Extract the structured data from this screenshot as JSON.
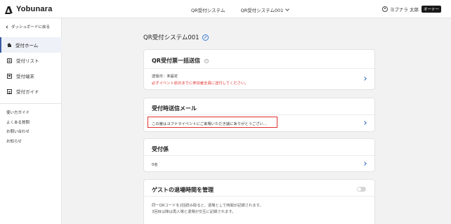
{
  "app": {
    "logo_text": "Yobunara"
  },
  "topnav": {
    "item1": "QR受付システム",
    "item2": "QR受付システム001"
  },
  "user": {
    "name": "ヨブナラ 太郎",
    "badge": "オーナー"
  },
  "sidebar": {
    "back_label": "ダッシュボードに戻る",
    "items": [
      {
        "label": "受付ホーム",
        "icon": "home-icon",
        "active": true
      },
      {
        "label": "受付リスト",
        "icon": "list-icon",
        "active": false
      },
      {
        "label": "受付端末",
        "icon": "terminal-icon",
        "active": false
      },
      {
        "label": "受付ガイド",
        "icon": "guide-icon",
        "active": false
      }
    ],
    "links": [
      "使い方ガイド",
      "よくある質問",
      "お問い合わせ",
      "お知らせ"
    ]
  },
  "main": {
    "page_title": "QR受付システム001",
    "cards": {
      "qr_send": {
        "title": "QR受付票一括送信",
        "send_date": "送信日：未設定",
        "warning": "必ずイベント前日までに参加者全員に送付してください。"
      },
      "mail": {
        "title": "受付時送信メール",
        "preview": "この度はヨブナライベントにご来場いただき誠にありがとうござい…"
      },
      "staff": {
        "title": "受付係",
        "count": "0名"
      },
      "exit_time": {
        "title": "ゲストの退場時間を管理",
        "desc1": "同一QRコードを2回読み取ると、退場として時間が記録されます。",
        "desc2": "3回目以降は再入場と退場が交互に記録されます。"
      }
    }
  },
  "colors": {
    "accent": "#3a6dc4",
    "warning": "#e0312f",
    "active_bg": "#eef1f7"
  }
}
